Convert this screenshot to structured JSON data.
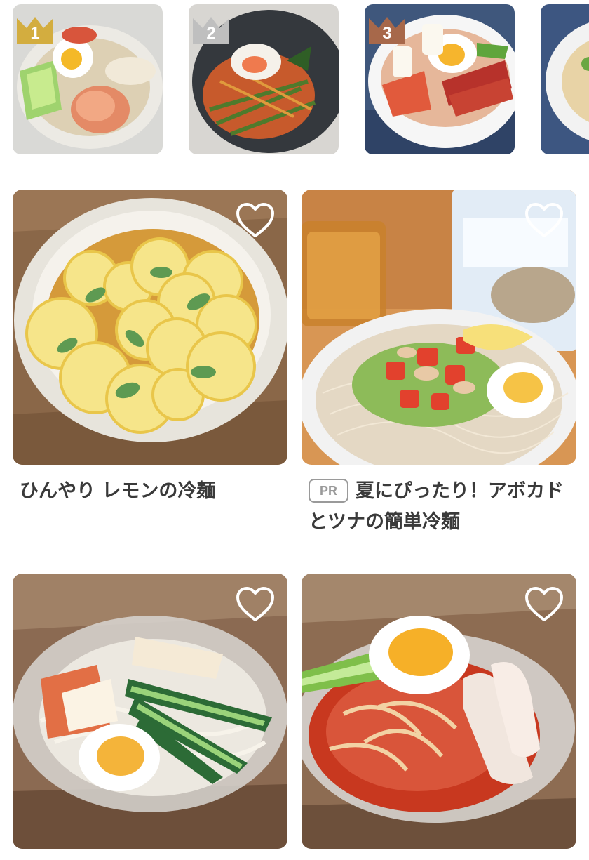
{
  "ranking": [
    {
      "rank": "1",
      "crown_color": "#d3ad3f",
      "photo": "cold noodles with egg, cucumber and ham"
    },
    {
      "rank": "2",
      "crown_color": "#bfbfbf",
      "photo": "spicy noodles with poached egg"
    },
    {
      "rank": "3",
      "crown_color": "#a7684a",
      "photo": "naengmyeon with egg, ham and kimchi"
    },
    {
      "rank": "",
      "crown_color": "",
      "photo": "noodle bowl (partially visible)"
    }
  ],
  "recipes": [
    {
      "title": "ひんやり レモンの冷麺",
      "pr": false
    },
    {
      "title": "夏にぴったり！アボカドとツナの簡単冷麺",
      "pr": true,
      "pr_label": "PR"
    },
    {
      "title": "",
      "pr": false
    },
    {
      "title": "",
      "pr": false
    }
  ],
  "icons": {
    "favorite": "heart-outline-icon",
    "rank": "crown-icon"
  }
}
